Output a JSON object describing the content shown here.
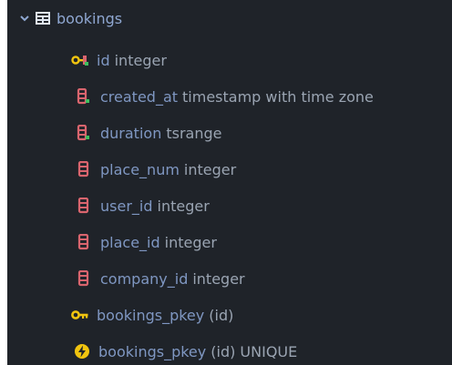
{
  "tree": {
    "table": {
      "name": "bookings",
      "expanded_icon": "chevron-down-icon",
      "table_icon": "table-grid-icon"
    },
    "columns": [
      {
        "name": "id",
        "type": "integer",
        "icon": "primary-key-column-icon"
      },
      {
        "name": "created_at",
        "type": "timestamp with time zone",
        "icon": "not-null-column-icon"
      },
      {
        "name": "duration",
        "type": "tsrange",
        "icon": "not-null-column-icon"
      },
      {
        "name": "place_num",
        "type": "integer",
        "icon": "column-icon"
      },
      {
        "name": "user_id",
        "type": "integer",
        "icon": "column-icon"
      },
      {
        "name": "place_id",
        "type": "integer",
        "icon": "column-icon"
      },
      {
        "name": "company_id",
        "type": "integer",
        "icon": "column-icon"
      }
    ],
    "keys": [
      {
        "name": "bookings_pkey",
        "detail": "(id)",
        "icon": "key-icon"
      }
    ],
    "indexes": [
      {
        "name": "bookings_pkey",
        "detail": "(id) UNIQUE",
        "icon": "index-lightning-icon"
      }
    ]
  },
  "colors": {
    "panel_background": "#1f2329",
    "name_text": "#7f97c2",
    "type_text": "#9aa4b2",
    "column_icon": "#d9656e",
    "key_icon": "#f1c40f",
    "not_null_marker": "#3fbf5f"
  }
}
